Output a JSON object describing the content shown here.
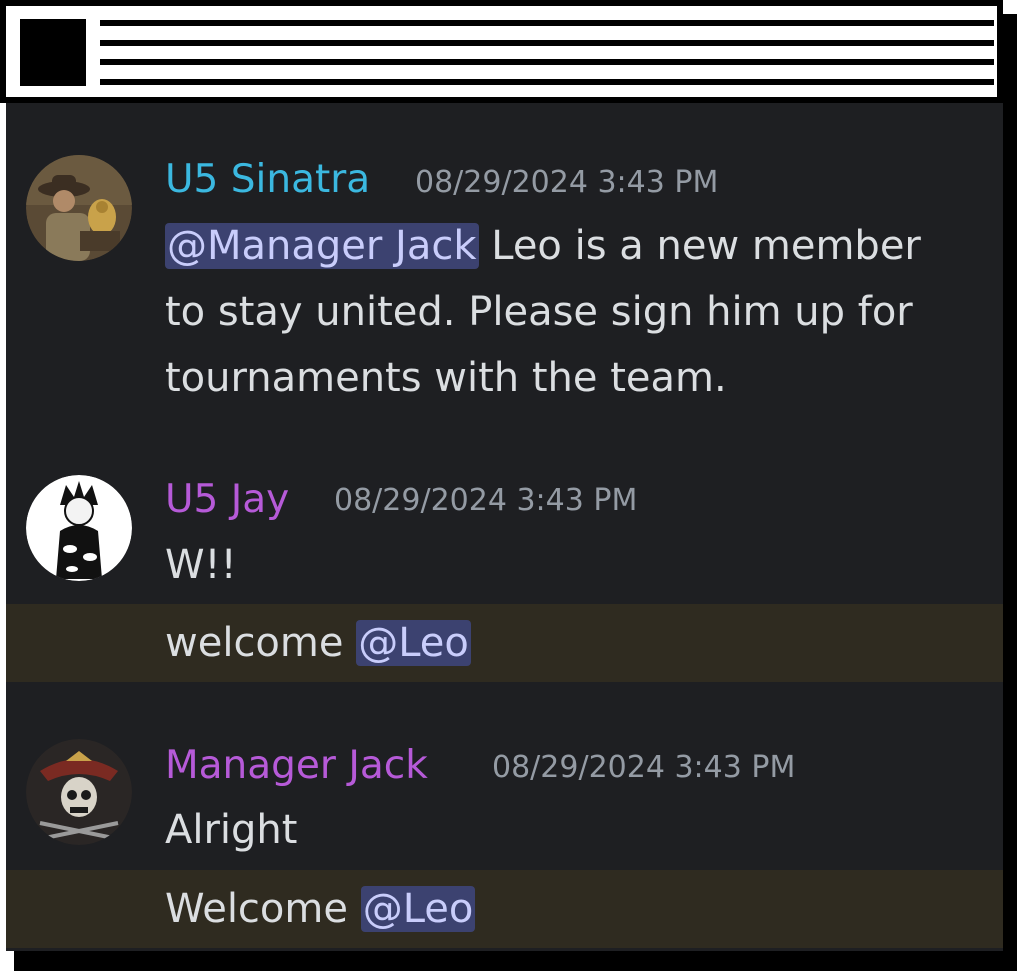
{
  "messages": [
    {
      "username": "U5 Sinatra",
      "username_color": "#3bb8e0",
      "timestamp": "08/29/2024 3:43 PM",
      "mention": "@Manager Jack",
      "line1_rest": " Leo is a new member",
      "line2": "to stay united. Please sign him up for",
      "line3": "tournaments with the team.",
      "avatar_icon": "adventurer-avatar-icon"
    },
    {
      "username": "U5 Jay",
      "username_color": "#b65ad8",
      "timestamp": "08/29/2024 3:43 PM",
      "line1": "W!!",
      "line2_text": "welcome ",
      "line2_mention": "@Leo",
      "avatar_icon": "anime-ninja-avatar-icon"
    },
    {
      "username": "Manager Jack",
      "username_color": "#b65ad8",
      "timestamp": "08/29/2024 3:43 PM",
      "line1": "Alright",
      "line2_text": "Welcome ",
      "line2_mention": "@Leo",
      "avatar_icon": "pirate-skull-avatar-icon"
    }
  ],
  "colors": {
    "background": "#1e1f22",
    "mention_highlight_row": "#2f2b20",
    "mention_bg": "#3c4270",
    "mention_text": "#c9cdfb",
    "message_text": "#dbdee1",
    "timestamp": "#949ba4"
  }
}
